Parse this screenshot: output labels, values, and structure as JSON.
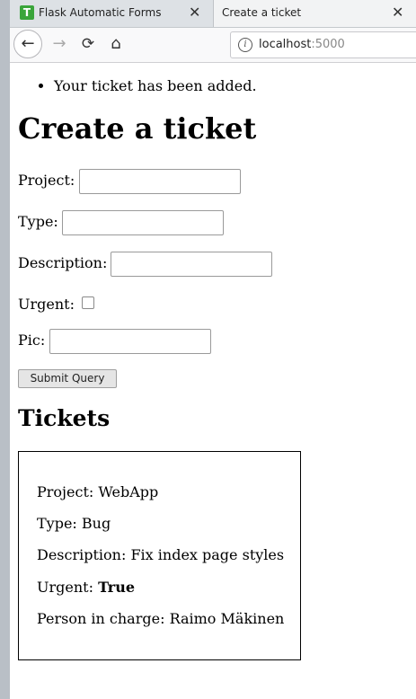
{
  "browser": {
    "tabs": [
      {
        "title": "Flask Automatic Forms",
        "favicon": "T",
        "active": false
      },
      {
        "title": "Create a ticket",
        "active": true
      }
    ],
    "address": {
      "host": "localhost",
      "port": ":5000"
    }
  },
  "page": {
    "flash_messages": [
      "Your ticket has been added."
    ],
    "title": "Create a ticket",
    "form": {
      "project_label": "Project:",
      "type_label": "Type:",
      "description_label": "Description:",
      "urgent_label": "Urgent:",
      "pic_label": "Pic:",
      "submit_label": "Submit Query"
    },
    "tickets_heading": "Tickets",
    "tickets": [
      {
        "project_label": "Project:",
        "project": "WebApp",
        "type_label": "Type:",
        "type": "Bug",
        "description_label": "Description:",
        "description": "Fix index page styles",
        "urgent_label": "Urgent:",
        "urgent": "True",
        "person_label": "Person in charge:",
        "person": "Raimo Mäkinen"
      }
    ]
  }
}
